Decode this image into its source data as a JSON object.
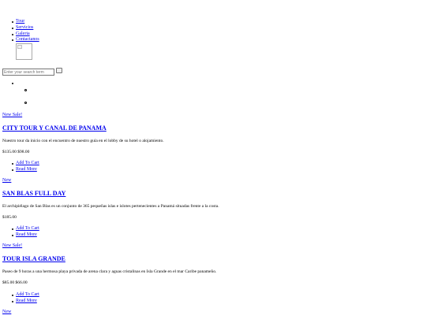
{
  "nav": {
    "items": [
      {
        "label": "Tour"
      },
      {
        "label": "Servicios"
      },
      {
        "label": "Galeria"
      },
      {
        "label": "Contactanos"
      }
    ]
  },
  "search": {
    "placeholder": "Enter your search term"
  },
  "products": [
    {
      "badge": "New Sale!",
      "title": "CITY TOUR Y CANAL DE PANAMA",
      "description": "Nuestro tour da inicio con el encuentro de nuestro guía en el lobby de su hotel o alojamiento.",
      "price": "$135.00 $98.00",
      "add_to_cart": "Add To Cart",
      "read_more": "Read More"
    },
    {
      "badge": "New",
      "title": "SAN BLAS FULL DAY",
      "description": "El archipiélago de San Blas es un conjunto de 365 pequeñas islas e islotes pertenecientes a Panamá situadas frente a la costa.",
      "price": "$185.00",
      "add_to_cart": "Add To Cart",
      "read_more": "Read More"
    },
    {
      "badge": "New Sale!",
      "title": "TOUR ISLA GRANDE",
      "description": "Paseo de 9 horas a una hermosa playa privada de arena clara y aguas cristalinas en Isla Grande en el mar Caribe panameño.",
      "price": "$85.00 $66.00",
      "add_to_cart": "Add To Cart",
      "read_more": "Read More"
    },
    {
      "badge": "New"
    }
  ]
}
